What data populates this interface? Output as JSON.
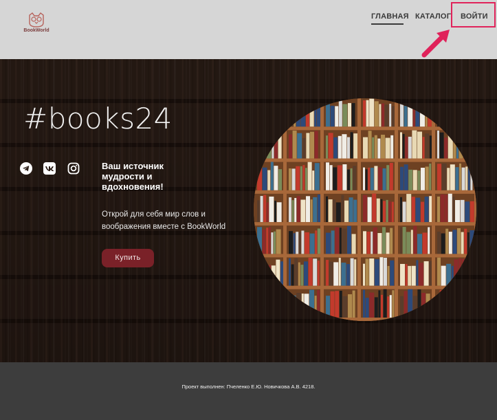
{
  "brand": {
    "name": "BookWorld"
  },
  "nav": {
    "home": "ГЛАВНАЯ",
    "catalog": "КАТАЛОГ",
    "login": "ВОЙТИ"
  },
  "hero": {
    "title": "#books24",
    "tagline": "Ваш источник мудрости и вдохновения!",
    "description": "Открой для себя мир слов и воображения вместе с BookWorld",
    "buy_button": "Купить",
    "social_icons": [
      "telegram-icon",
      "vk-icon",
      "instagram-icon"
    ]
  },
  "footer": {
    "text": "Проект выполнен: Пчеленко Е.Ю. Новичкова А.В. 4218."
  },
  "colors": {
    "accent": "#7a2128",
    "highlight": "#e0225a",
    "header_bg": "#d6d6d6",
    "footer_bg": "#3d3d3d"
  }
}
